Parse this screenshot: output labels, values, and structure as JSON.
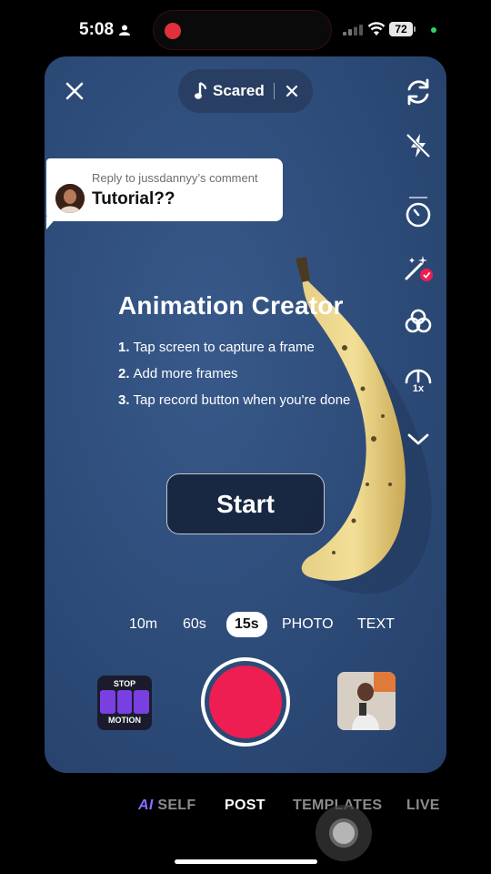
{
  "status_bar": {
    "time": "5:08",
    "battery": "72"
  },
  "top": {
    "sound_name": "Scared"
  },
  "reply": {
    "meta": "Reply to jussdannyy’s comment",
    "text": "Tutorial??"
  },
  "overlay": {
    "title": "Animation Creator",
    "steps": [
      {
        "num": "1.",
        "text": "Tap screen to capture a frame"
      },
      {
        "num": "2.",
        "text": "Add more frames"
      },
      {
        "num": "3.",
        "text": "Tap record button when you're done"
      }
    ],
    "start_label": "Start"
  },
  "tools": {
    "speed_label": "1x"
  },
  "modes": [
    {
      "label": "10m",
      "active": false
    },
    {
      "label": "60s",
      "active": false
    },
    {
      "label": "15s",
      "active": true
    },
    {
      "label": "PHOTO",
      "active": false
    },
    {
      "label": "TEXT",
      "active": false
    }
  ],
  "effect": {
    "top_label": "STOP",
    "bottom_label": "MOTION"
  },
  "nav": {
    "ai": "AI",
    "self": "SELF",
    "post": "POST",
    "templates": "TEMPLATES",
    "live": "LIVE"
  },
  "colors": {
    "record": "#ee1d52",
    "ai_accent": "#8b6cff",
    "background": "#2d4b78"
  }
}
